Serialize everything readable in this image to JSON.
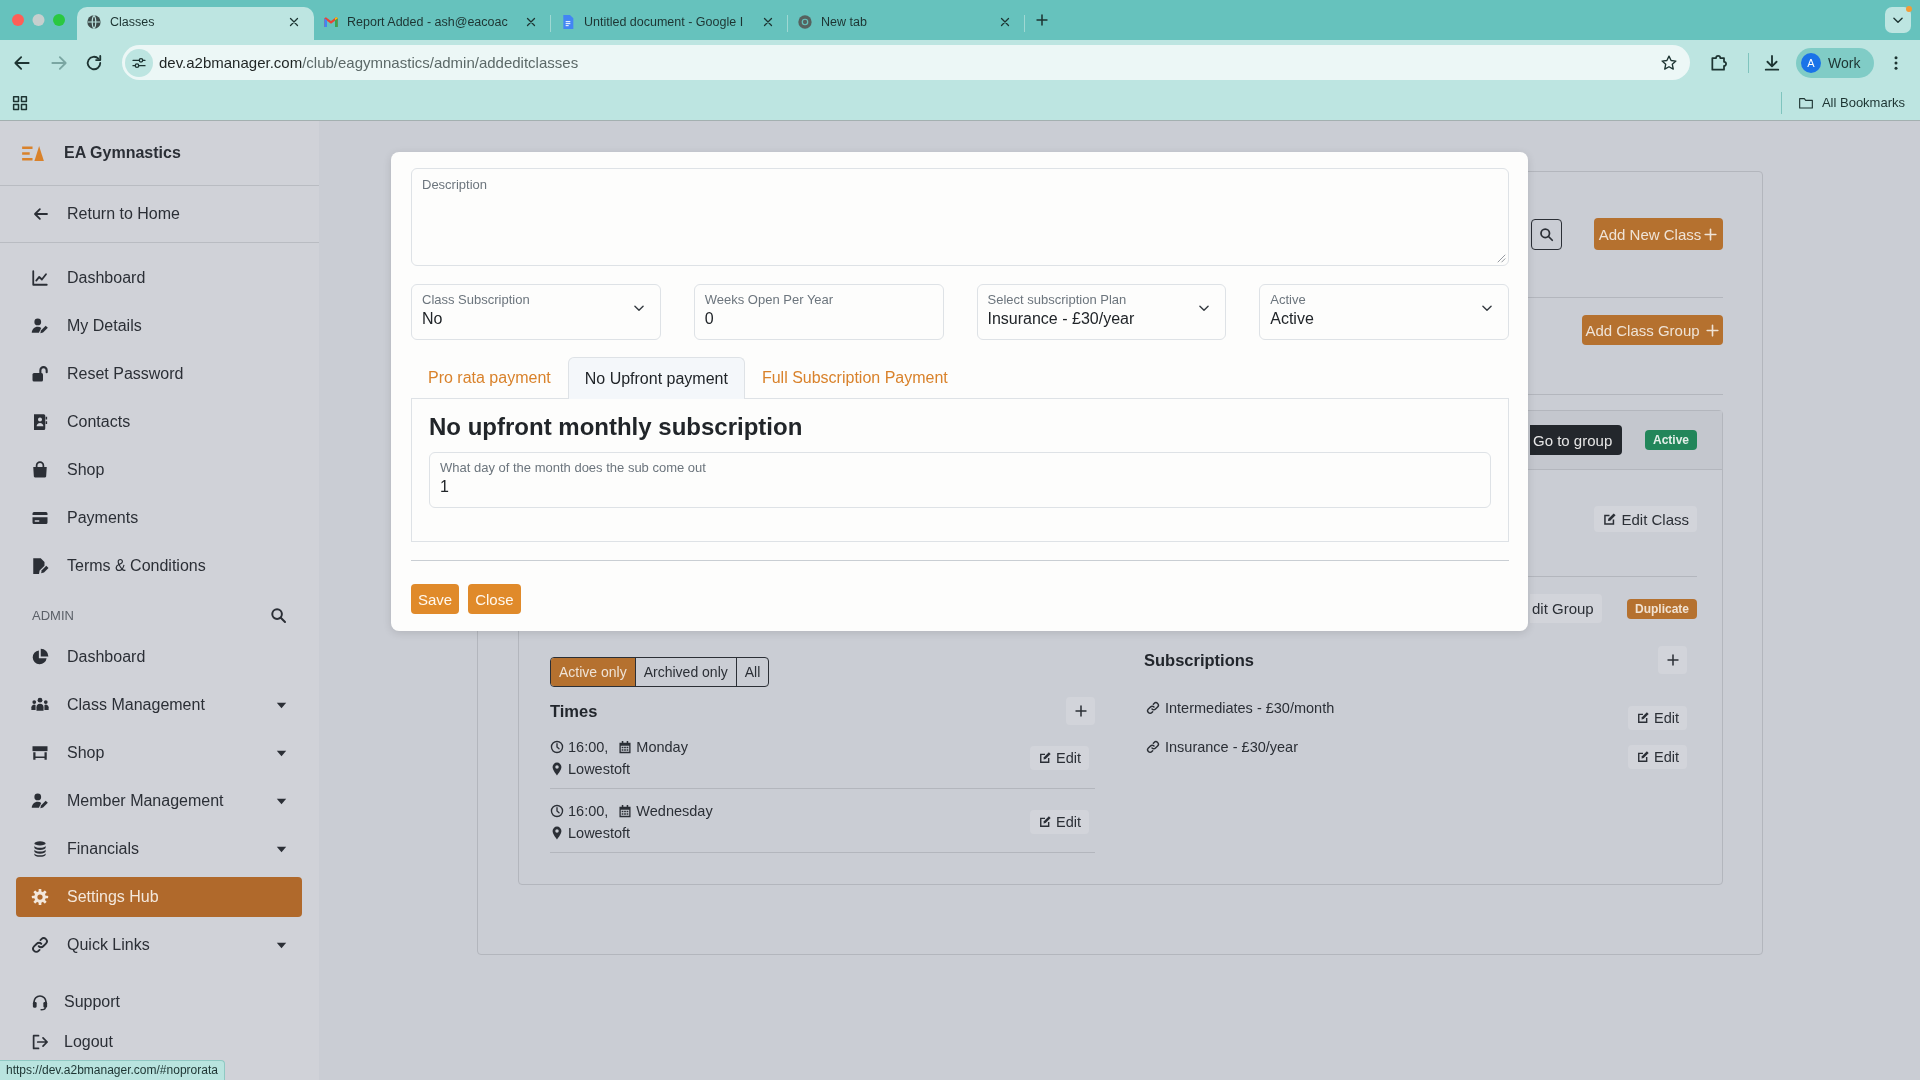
{
  "browser": {
    "tabs": [
      {
        "kind": "site",
        "title": "Classes",
        "selected": true
      },
      {
        "kind": "mail",
        "title": "Report Added - ash@eacoac",
        "selected": false
      },
      {
        "kind": "document",
        "title": "Untitled document - Google I",
        "selected": false
      },
      {
        "kind": "newtab",
        "title": "New tab",
        "selected": false
      }
    ],
    "address": {
      "host": "dev.a2bmanager.com",
      "path": "/club/eagymnastics/admin/addeditclasses"
    },
    "profile": {
      "initial": "A",
      "label": "Work"
    },
    "bookmarks_folder": "All Bookmarks",
    "status_url": "https://dev.a2bmanager.com/#noprorata"
  },
  "sidebar": {
    "brand": "EA Gymnastics",
    "back_link": "Return to Home",
    "items": [
      {
        "label": "Dashboard",
        "selected": false
      },
      {
        "label": "My Details",
        "selected": false
      },
      {
        "label": "Reset Password",
        "selected": false
      },
      {
        "label": "Contacts",
        "selected": false
      },
      {
        "label": "Shop",
        "selected": false
      },
      {
        "label": "Payments",
        "selected": false
      },
      {
        "label": "Terms & Conditions",
        "selected": false
      }
    ],
    "admin_heading": "ADMIN",
    "admin_items": [
      {
        "label": "Dashboard",
        "has_submenu": false,
        "selected": false
      },
      {
        "label": "Class Management",
        "has_submenu": true,
        "selected": false
      },
      {
        "label": "Shop",
        "has_submenu": true,
        "selected": false
      },
      {
        "label": "Member Management",
        "has_submenu": true,
        "selected": false
      },
      {
        "label": "Financials",
        "has_submenu": true,
        "selected": false
      },
      {
        "label": "Settings Hub",
        "has_submenu": false,
        "selected": true
      },
      {
        "label": "Quick Links",
        "has_submenu": true,
        "selected": false
      }
    ],
    "footer_items": [
      "Support",
      "Logout"
    ]
  },
  "page": {
    "add_class_button": "Add New Class",
    "add_group_button": "Add Class Group",
    "group": {
      "go_to_group_button": "Go to group",
      "status_badge": "Active",
      "edit_class_button": "Edit Class",
      "edit_group_button": "dit Group",
      "duplicate_button": "Duplicate",
      "filter": [
        {
          "label": "Active only",
          "selected": true
        },
        {
          "label": "Archived only",
          "selected": false
        },
        {
          "label": "All",
          "selected": false
        }
      ],
      "times": {
        "heading": "Times",
        "rows": [
          {
            "time": "16:00,",
            "day": "Monday",
            "location": "Lowestoft",
            "edit": "Edit"
          },
          {
            "time": "16:00,",
            "day": "Wednesday",
            "location": "Lowestoft",
            "edit": "Edit"
          }
        ]
      },
      "subscriptions": {
        "heading": "Subscriptions",
        "rows": [
          {
            "name": "Intermediates - £30/month",
            "edit": "Edit"
          },
          {
            "name": "Insurance - £30/year",
            "edit": "Edit"
          }
        ]
      }
    }
  },
  "modal": {
    "description": {
      "label": "Description"
    },
    "fields": [
      {
        "kind": "select",
        "label": "Class Subscription",
        "value": "No"
      },
      {
        "kind": "text",
        "label": "Weeks Open Per Year",
        "value": "0"
      },
      {
        "kind": "select",
        "label": "Select subscription Plan",
        "value": "Insurance - £30/year"
      },
      {
        "kind": "select",
        "label": "Active",
        "value": "Active"
      }
    ],
    "payment_tabs": [
      {
        "label": "Pro rata payment",
        "selected": false
      },
      {
        "label": "No Upfront payment",
        "selected": true
      },
      {
        "label": "Full Subscription Payment",
        "selected": false
      }
    ],
    "panel": {
      "heading": "No upfront monthly subscription",
      "field": {
        "label": "What day of the month does the sub come out",
        "value": "1"
      }
    },
    "buttons": [
      "Save",
      "Close"
    ]
  }
}
